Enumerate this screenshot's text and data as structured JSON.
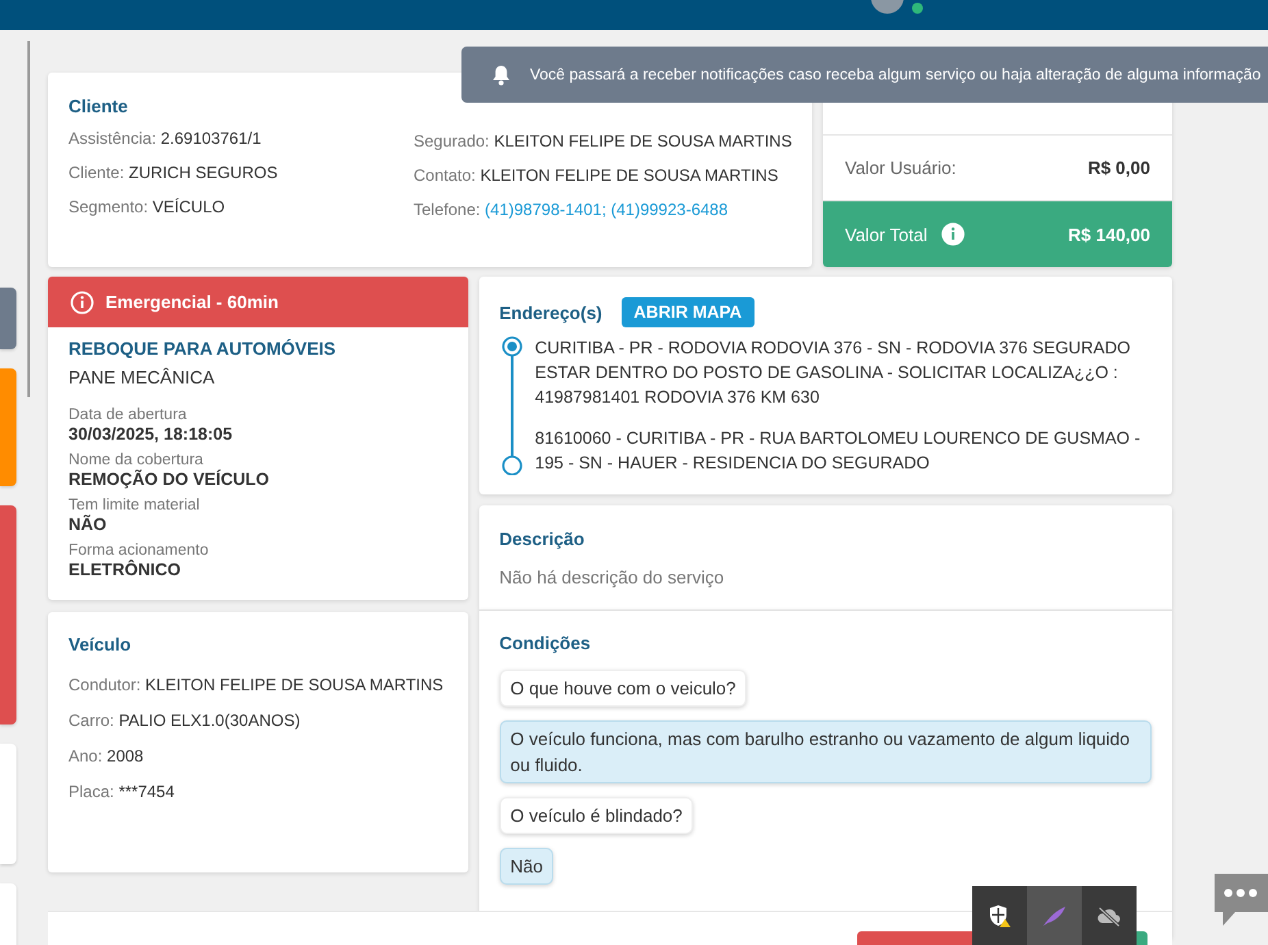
{
  "notification": {
    "text": "Você passará a receber notificações caso receba algum serviço ou haja alteração de alguma informação"
  },
  "client": {
    "title": "Cliente",
    "left": [
      {
        "label": "Assistência:",
        "value": "2.69103761/1"
      },
      {
        "label": "Cliente:",
        "value": "ZURICH SEGUROS"
      },
      {
        "label": "Segmento:",
        "value": "VEÍCULO"
      }
    ],
    "right": [
      {
        "label": "Segurado:",
        "value": "KLEITON FELIPE DE SOUSA MARTINS"
      },
      {
        "label": "Contato:",
        "value": "KLEITON FELIPE DE SOUSA MARTINS"
      }
    ],
    "phone": {
      "label": "Telefone:",
      "value": "(41)98798-1401; (41)99923-6488"
    }
  },
  "values": [
    {
      "label": "Valor Usuário:",
      "value": "R$ 0,00",
      "kind": "plain"
    },
    {
      "label": "Valor Total",
      "value": "R$ 140,00",
      "kind": "total"
    }
  ],
  "service": {
    "badge": "Emergencial - 60min",
    "title": "REBOQUE PARA AUTOMÓVEIS",
    "subtitle": "PANE MECÂNICA",
    "details": [
      {
        "label": "Data de abertura",
        "value": "30/03/2025, 18:18:05"
      },
      {
        "label": "Nome da cobertura",
        "value": "REMOÇÃO DO VEÍCULO"
      },
      {
        "label": "Tem limite material",
        "value": "NÃO"
      },
      {
        "label": "Forma acionamento",
        "value": "ELETRÔNICO"
      }
    ]
  },
  "vehicle": {
    "title": "Veículo",
    "fields": [
      {
        "label": "Condutor:",
        "value": "KLEITON FELIPE DE SOUSA MARTINS"
      },
      {
        "label": "Carro:",
        "value": "PALIO ELX1.0(30ANOS)"
      },
      {
        "label": "Ano:",
        "value": "2008"
      },
      {
        "label": "Placa:",
        "value": "***7454"
      }
    ]
  },
  "addresses": {
    "title": "Endereço(s)",
    "button": "ABRIR MAPA",
    "items": [
      {
        "kind": "origin",
        "text": "CURITIBA - PR - RODOVIA RODOVIA 376 - SN - RODOVIA 376 SEGURADO ESTAR DENTRO DO POSTO DE GASOLINA - SOLICITAR LOCALIZA¿¿O : 41987981401 RODOVIA 376 KM 630"
      },
      {
        "kind": "destination",
        "text": "81610060 - CURITIBA - PR - RUA BARTOLOMEU LOURENCO DE GUSMAO - 195 - SN - HAUER - RESIDENCIA DO SEGURADO"
      }
    ]
  },
  "description": {
    "title": "Descrição",
    "text": "Não há descrição do serviço"
  },
  "conditions": {
    "title": "Condições",
    "messages": [
      {
        "kind": "question",
        "text": "O que houve com o veiculo?"
      },
      {
        "kind": "answer",
        "text": "O veículo funciona, mas com barulho estranho ou vazamento de algum liquido ou fluido."
      },
      {
        "kind": "question",
        "text": "O veículo é blindado?"
      },
      {
        "kind": "answer",
        "text": "Não"
      }
    ]
  }
}
